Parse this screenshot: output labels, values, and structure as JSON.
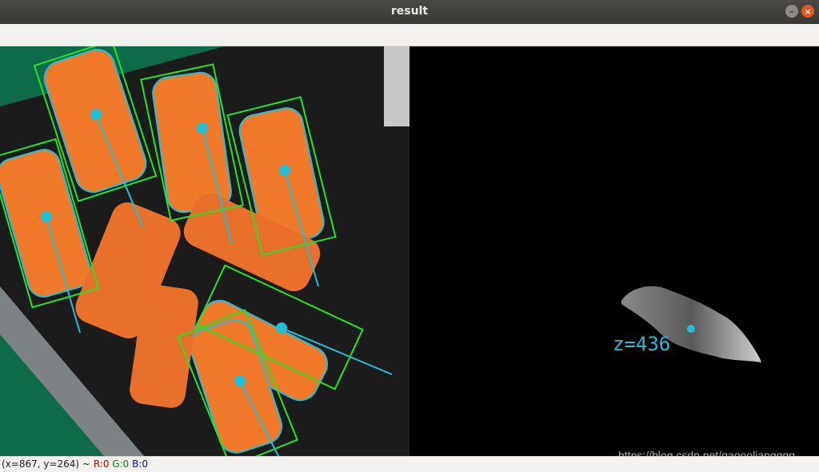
{
  "window": {
    "title": "result",
    "minimize_icon": "minimize-icon",
    "close_icon": "close-icon"
  },
  "left_panel": {
    "belt_color": "#1b1b1b",
    "background_color": "#0e6b4a",
    "bbox_color": "#22e622",
    "contour_color": "#1fc0d8",
    "item_color": "#f07a2a"
  },
  "right_panel": {
    "depth_label": "z=436",
    "watermark": "https://blog.csdn.net/gaoooliangggg"
  },
  "status": {
    "coords": "(x=867, y=264) ~",
    "r": "R:0",
    "g": "G:0",
    "b": "B:0"
  }
}
